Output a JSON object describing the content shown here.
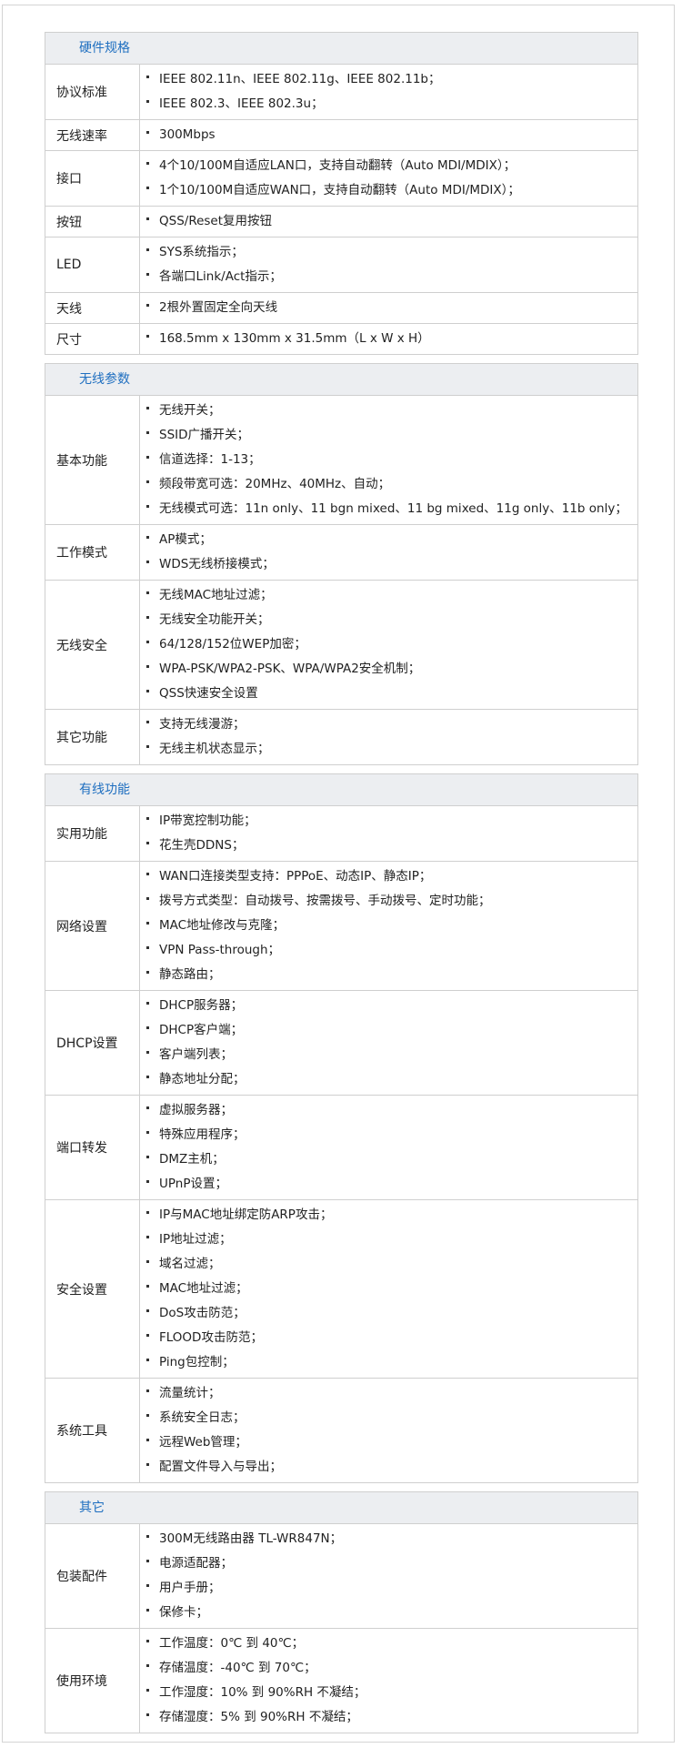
{
  "sections": [
    {
      "title": "硬件规格",
      "rows": [
        {
          "label": "协议标准",
          "values": [
            "IEEE 802.11n、IEEE 802.11g、IEEE 802.11b；",
            "IEEE 802.3、IEEE 802.3u；"
          ]
        },
        {
          "label": "无线速率",
          "values": [
            "300Mbps"
          ]
        },
        {
          "label": "接口",
          "values": [
            "4个10/100M自适应LAN口，支持自动翻转（Auto MDI/MDIX）；",
            "1个10/100M自适应WAN口，支持自动翻转（Auto MDI/MDIX）；"
          ]
        },
        {
          "label": "按钮",
          "values": [
            "QSS/Reset复用按钮"
          ]
        },
        {
          "label": "LED",
          "values": [
            "SYS系统指示；",
            "各端口Link/Act指示；"
          ]
        },
        {
          "label": "天线",
          "values": [
            "2根外置固定全向天线"
          ]
        },
        {
          "label": "尺寸",
          "values": [
            "168.5mm x 130mm x 31.5mm（L x W x H）"
          ]
        }
      ]
    },
    {
      "title": "无线参数",
      "rows": [
        {
          "label": "基本功能",
          "values": [
            "无线开关；",
            "SSID广播开关；",
            "信道选择：1-13；",
            "频段带宽可选：20MHz、40MHz、自动；",
            "无线模式可选：11n only、11 bgn mixed、11 bg mixed、11g only、11b only；"
          ]
        },
        {
          "label": "工作模式",
          "values": [
            "AP模式；",
            "WDS无线桥接模式；"
          ]
        },
        {
          "label": "无线安全",
          "values": [
            "无线MAC地址过滤；",
            "无线安全功能开关；",
            "64/128/152位WEP加密；",
            "WPA-PSK/WPA2-PSK、WPA/WPA2安全机制；",
            "QSS快速安全设置"
          ]
        },
        {
          "label": "其它功能",
          "values": [
            "支持无线漫游；",
            "无线主机状态显示；"
          ]
        }
      ]
    },
    {
      "title": "有线功能",
      "rows": [
        {
          "label": "实用功能",
          "values": [
            "IP带宽控制功能；",
            "花生壳DDNS；"
          ]
        },
        {
          "label": "网络设置",
          "values": [
            "WAN口连接类型支持：PPPoE、动态IP、静态IP；",
            "拨号方式类型：自动拨号、按需拨号、手动拨号、定时功能；",
            "MAC地址修改与克隆；",
            "VPN Pass-through；",
            "静态路由；"
          ]
        },
        {
          "label": "DHCP设置",
          "values": [
            "DHCP服务器；",
            "DHCP客户端；",
            "客户端列表；",
            "静态地址分配；"
          ]
        },
        {
          "label": "端口转发",
          "values": [
            "虚拟服务器；",
            "特殊应用程序；",
            "DMZ主机；",
            "UPnP设置；"
          ]
        },
        {
          "label": "安全设置",
          "values": [
            "IP与MAC地址绑定防ARP攻击；",
            "IP地址过滤；",
            "域名过滤；",
            "MAC地址过滤；",
            "DoS攻击防范；",
            "FLOOD攻击防范；",
            "Ping包控制；"
          ]
        },
        {
          "label": "系统工具",
          "values": [
            "流量统计；",
            "系统安全日志；",
            "远程Web管理；",
            "配置文件导入与导出；"
          ]
        }
      ]
    },
    {
      "title": "其它",
      "rows": [
        {
          "label": "包装配件",
          "values": [
            "300M无线路由器 TL-WR847N；",
            "电源适配器；",
            "用户手册；",
            "保修卡；"
          ]
        },
        {
          "label": "使用环境",
          "values": [
            "工作温度：0℃ 到 40℃；",
            "存储温度：-40℃ 到 70℃；",
            "工作湿度：10% 到 90%RH 不凝结；",
            "存储湿度：5% 到 90%RH 不凝结；"
          ]
        }
      ]
    }
  ]
}
